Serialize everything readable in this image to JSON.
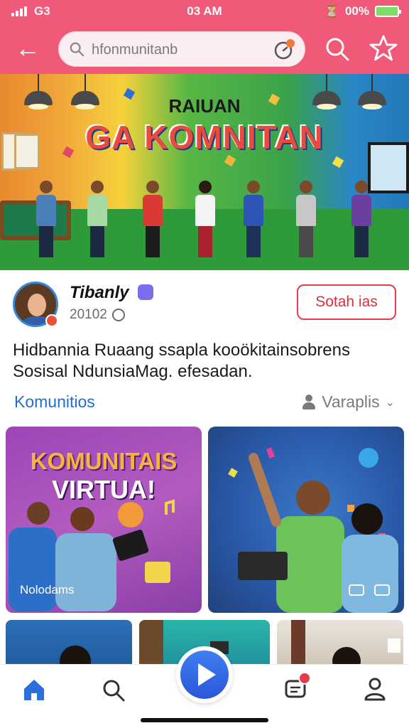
{
  "status_bar": {
    "carrier": "G3",
    "time": "03 AM",
    "battery": "00%",
    "signal_icon": "signal-bars-icon",
    "battery_color": "#7ddc6a"
  },
  "header": {
    "background_color": "#f05a78",
    "back_icon": "arrow-left-icon",
    "search_placeholder": "hfonmunitanb",
    "search_icon": "magnifier-icon",
    "timer_icon": "stopwatch-icon",
    "right_search_icon": "magnifier-icon",
    "star_icon": "star-outline-icon"
  },
  "hero": {
    "title_line1": "RAIUAN",
    "title_line2": "GA KOMNITAN"
  },
  "profile": {
    "name": "Tibanly",
    "id": "20102",
    "follow_label": "Sotah ias",
    "accent_color": "#e53e4a"
  },
  "description": "Hidbannia Ruaang ssapla kooökitainsobrens Sosisal NdunsiaMag. efesadan.",
  "section": {
    "left_label": "Komunitios",
    "right_label": "Varaplis",
    "left_color": "#1e6fd0"
  },
  "cards": [
    {
      "title_line1": "KOMUNITAIS",
      "title_line2": "VIRTUA!",
      "caption": "Nolodams"
    },
    {
      "title_line1": "",
      "title_line2": "",
      "caption": ""
    }
  ],
  "bottom_nav": {
    "items": [
      {
        "icon": "home-icon",
        "active": true
      },
      {
        "icon": "search-icon",
        "active": false
      },
      {
        "icon": "play-icon",
        "active": false
      },
      {
        "icon": "chat-icon",
        "active": false
      },
      {
        "icon": "profile-icon",
        "active": false
      }
    ],
    "active_color": "#2b6fdc"
  }
}
